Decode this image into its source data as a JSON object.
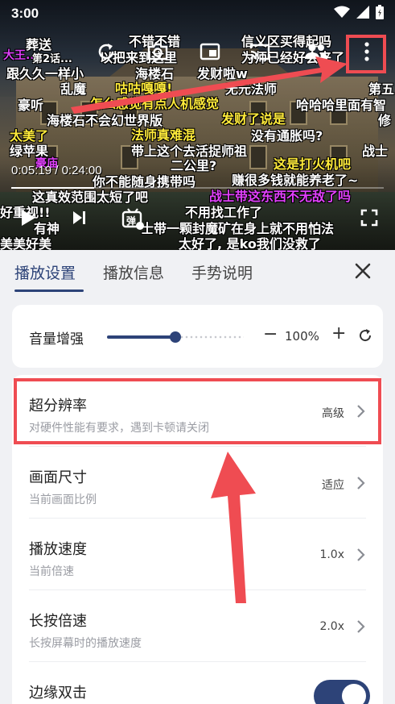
{
  "status_bar": {
    "time": "3:00"
  },
  "video": {
    "current_time": "0:05:19",
    "total_time": "0:24:00",
    "time_separator": " / ",
    "progress": 0.222,
    "danmaku": [
      {
        "text": "葬送",
        "color": "white"
      },
      {
        "text": "不错不错",
        "color": "white"
      },
      {
        "text": "信义区买得起吗",
        "color": "white"
      },
      {
        "text": "大王...",
        "color": "pink"
      },
      {
        "text": "第2话...",
        "color": "white"
      },
      {
        "text": "以把来到这里",
        "color": "white"
      },
      {
        "text": "为师已经好会来了",
        "color": "white"
      },
      {
        "text": "跟久久一样小",
        "color": "white"
      },
      {
        "text": "海楼石",
        "color": "white"
      },
      {
        "text": "发财啦w",
        "color": "white"
      },
      {
        "text": "乱魔",
        "color": "white"
      },
      {
        "text": "咕咕嘎嘎!",
        "color": "yellow"
      },
      {
        "text": "无元法师",
        "color": "white"
      },
      {
        "text": "第五",
        "color": "white"
      },
      {
        "text": "豪听",
        "color": "white"
      },
      {
        "text": "怎么感觉有点人机感觉",
        "color": "yellow"
      },
      {
        "text": "哈哈哈里面有智",
        "color": "white"
      },
      {
        "text": "海楼石不会幻世界版",
        "color": "white"
      },
      {
        "text": "发财了说是",
        "color": "yellow"
      },
      {
        "text": "修",
        "color": "white"
      },
      {
        "text": "太美了",
        "color": "yellow"
      },
      {
        "text": "法师真难混",
        "color": "yellow"
      },
      {
        "text": "没有通胀吗?",
        "color": "white"
      },
      {
        "text": "绿苹果",
        "color": "white"
      },
      {
        "text": "带上这个去活捉师祖",
        "color": "white"
      },
      {
        "text": "这是打火机吧",
        "color": "yellow"
      },
      {
        "text": "战士",
        "color": "white"
      },
      {
        "text": "豪庙",
        "color": "pink"
      },
      {
        "text": "二公里?",
        "color": "white"
      },
      {
        "text": "赚很多钱就能养老了~",
        "color": "white"
      },
      {
        "text": "你不能随身携带吗",
        "color": "white"
      },
      {
        "text": "这真效范围太短了吧",
        "color": "white"
      },
      {
        "text": "战士带这东西不无敌了吗",
        "color": "pink"
      },
      {
        "text": "好重视!!",
        "color": "white"
      },
      {
        "text": "不用找工作了",
        "color": "white"
      },
      {
        "text": "有神",
        "color": "white"
      },
      {
        "text": "士带一颗封魔矿在身上就不用怕法",
        "color": "white"
      },
      {
        "text": "美美好美",
        "color": "white"
      },
      {
        "text": "太好了, 是ko我们没救了",
        "color": "white"
      }
    ],
    "danmaku_toggle_label": "弹"
  },
  "tabs": [
    {
      "label": "播放设置",
      "active": true
    },
    {
      "label": "播放信息",
      "active": false
    },
    {
      "label": "手势说明",
      "active": false
    }
  ],
  "volume": {
    "label": "音量增强",
    "value_text": "100%",
    "level": 0.5,
    "minus": "−",
    "plus": "+"
  },
  "settings": [
    {
      "title": "超分辨率",
      "subtitle": "对硬件性能有要求，遇到卡顿请关闭",
      "value": "高级",
      "control": "chevron"
    },
    {
      "title": "画面尺寸",
      "subtitle": "当前画面比例",
      "value": "适应",
      "control": "chevron"
    },
    {
      "title": "播放速度",
      "subtitle": "当前倍速",
      "value": "1.0x",
      "control": "chevron"
    },
    {
      "title": "长按倍速",
      "subtitle": "长按屏幕时的播放速度",
      "value": "2.0x",
      "control": "chevron"
    },
    {
      "title": "边缘双击",
      "subtitle": "",
      "value": "",
      "control": "toggle",
      "toggle_on": true
    }
  ],
  "colors": {
    "accent": "#2d4378",
    "highlight_red": "#ef4c52",
    "sheet_bg": "#f0f1f4",
    "card_bg": "#ffffff"
  },
  "icons": {
    "top_controls": [
      "refresh-icon",
      "camera-icon",
      "picture-in-picture-icon",
      "cast-icon",
      "watch-together-icon",
      "more-vertical-icon"
    ],
    "bottom_controls": [
      "play-icon",
      "skip-next-icon",
      "danmaku-toggle-icon",
      "fullscreen-icon"
    ]
  }
}
